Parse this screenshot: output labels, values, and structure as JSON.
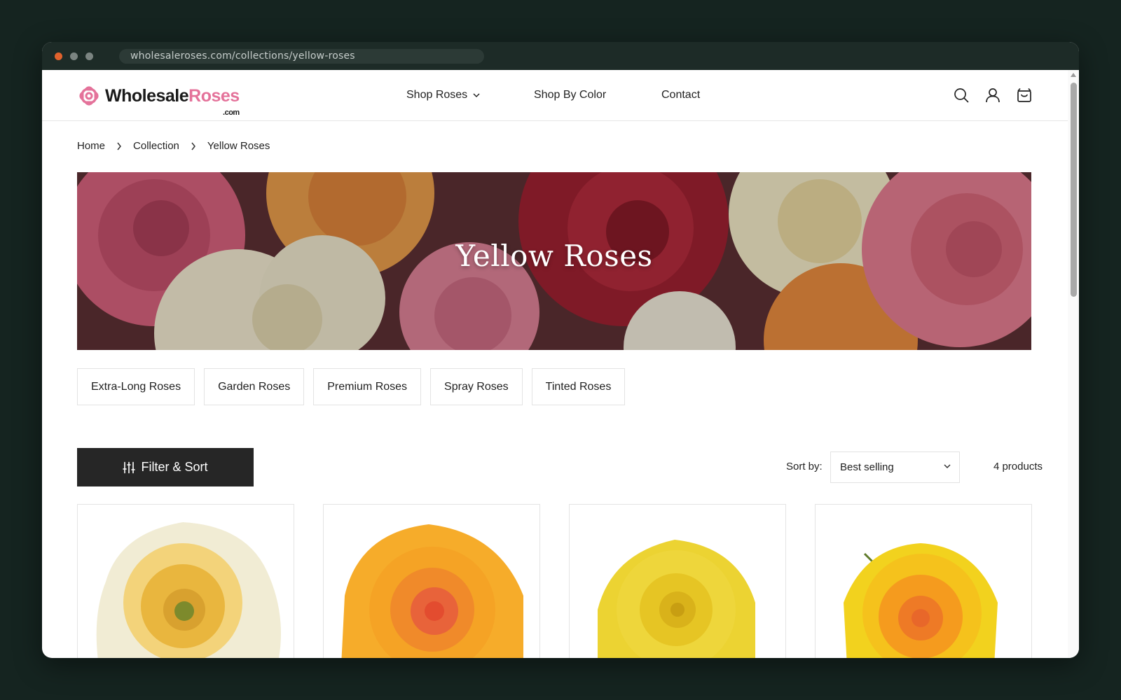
{
  "browser": {
    "url": "wholesaleroses.com/collections/yellow-roses"
  },
  "header": {
    "logo": {
      "word1": "Wholesale",
      "word2": "Roses",
      "suffix": ".com"
    },
    "nav": [
      {
        "label": "Shop Roses",
        "has_dropdown": true
      },
      {
        "label": "Shop By Color",
        "has_dropdown": false
      },
      {
        "label": "Contact",
        "has_dropdown": false
      }
    ],
    "icons": [
      "search-icon",
      "account-icon",
      "cart-icon"
    ]
  },
  "breadcrumb": [
    "Home",
    "Collection",
    "Yellow Roses"
  ],
  "hero": {
    "title": "Yellow Roses"
  },
  "categories": [
    "Extra-Long Roses",
    "Garden Roses",
    "Premium Roses",
    "Spray Roses",
    "Tinted Roses"
  ],
  "toolbar": {
    "filter_label": "Filter & Sort",
    "sort_label": "Sort by:",
    "sort_value": "Best selling",
    "product_count": "4 products"
  },
  "colors": {
    "brand_pink": "#e4729a",
    "dark_button": "#262626",
    "window_frame": "#1d2b27"
  }
}
